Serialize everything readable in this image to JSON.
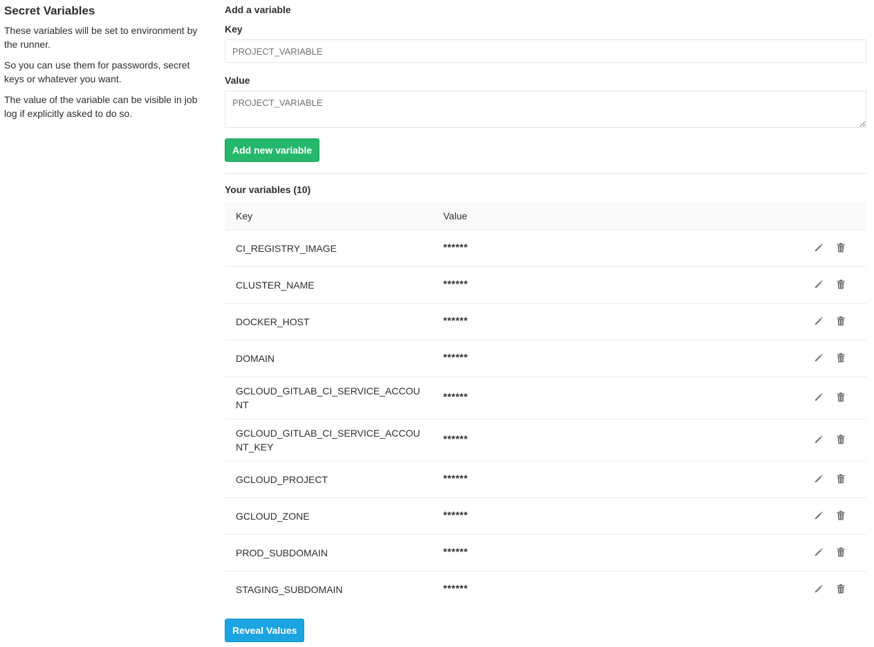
{
  "sidebar": {
    "title": "Secret Variables",
    "paragraphs": [
      "These variables will be set to environment by the runner.",
      "So you can use them for passwords, secret keys or whatever you want.",
      "The value of the variable can be visible in job log if explicitly asked to do so."
    ]
  },
  "form": {
    "title": "Add a variable",
    "key_label": "Key",
    "key_placeholder": "PROJECT_VARIABLE",
    "value_label": "Value",
    "value_placeholder": "PROJECT_VARIABLE",
    "add_button": "Add new variable"
  },
  "variables": {
    "title": "Your variables (10)",
    "columns": [
      "Key",
      "Value"
    ],
    "rows": [
      {
        "key": "CI_REGISTRY_IMAGE",
        "value": "******"
      },
      {
        "key": "CLUSTER_NAME",
        "value": "******"
      },
      {
        "key": "DOCKER_HOST",
        "value": "******"
      },
      {
        "key": "DOMAIN",
        "value": "******"
      },
      {
        "key": "GCLOUD_GITLAB_CI_SERVICE_ACCOUNT",
        "value": "******"
      },
      {
        "key": "GCLOUD_GITLAB_CI_SERVICE_ACCOUNT_KEY",
        "value": "******"
      },
      {
        "key": "GCLOUD_PROJECT",
        "value": "******"
      },
      {
        "key": "GCLOUD_ZONE",
        "value": "******"
      },
      {
        "key": "PROD_SUBDOMAIN",
        "value": "******"
      },
      {
        "key": "STAGING_SUBDOMAIN",
        "value": "******"
      }
    ],
    "row_icons": [
      "pencil-icon",
      "trash-icon"
    ],
    "reveal_button": "Reveal Values"
  },
  "colors": {
    "add_button": "#25b86c",
    "reveal_button": "#1aa4e0",
    "icon": "#707070"
  }
}
